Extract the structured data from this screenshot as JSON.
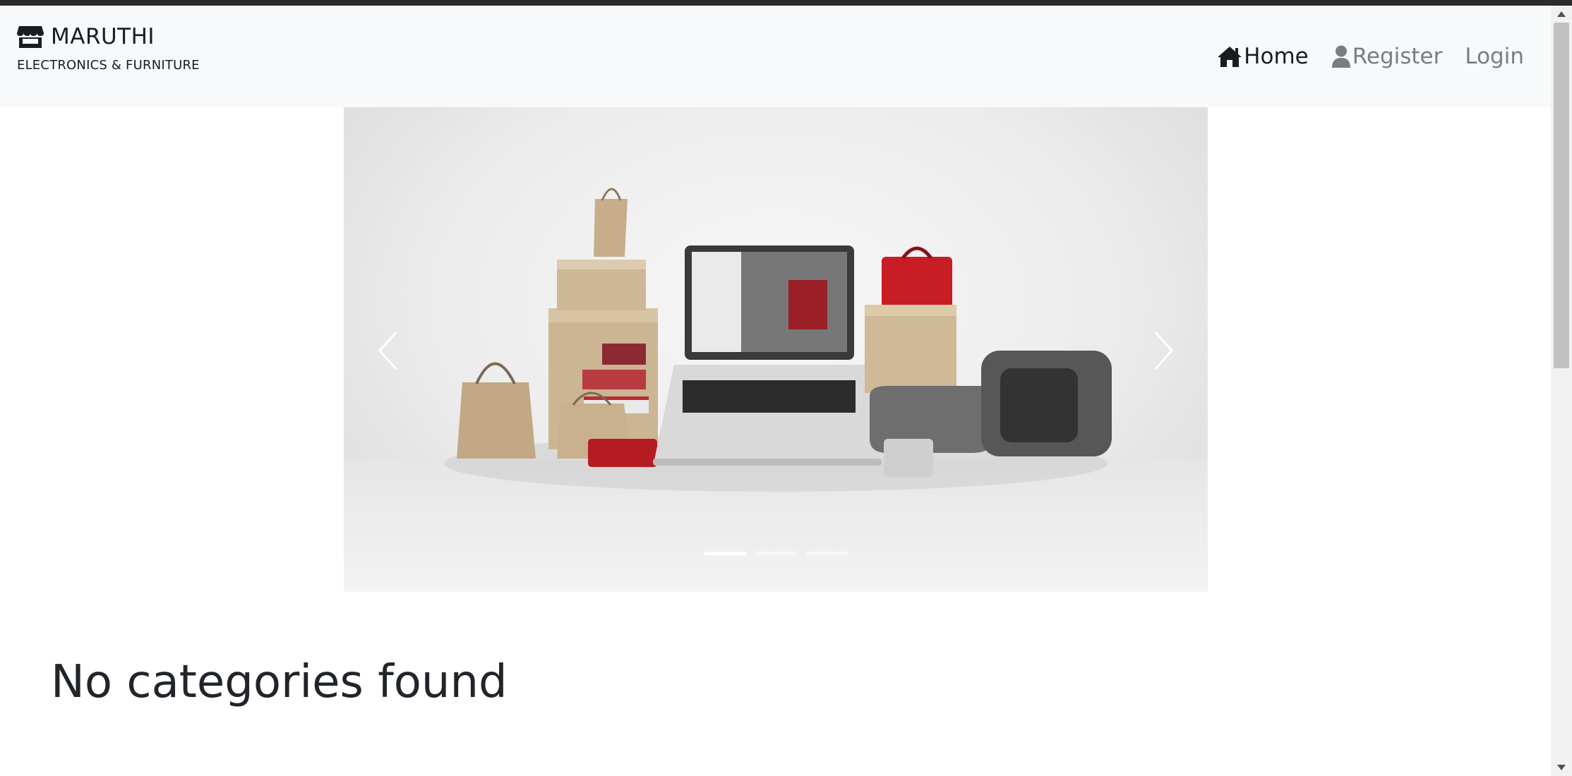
{
  "brand": {
    "name": "MARUTHI",
    "subtitle": "ELECTRONICS & FURNITURE",
    "icon": "store-icon"
  },
  "nav": {
    "home": "Home",
    "register": "Register",
    "login": "Login",
    "home_icon": "house-icon",
    "register_icon": "user-icon"
  },
  "carousel": {
    "slide_count": 3,
    "active_slide": 1,
    "image_alt": "laptop with bags and boxes"
  },
  "main": {
    "heading": "No categories found"
  },
  "colors": {
    "navbar_bg": "#f8f9fa",
    "active_link": "#1a1d20",
    "muted_link": "#787d82"
  }
}
